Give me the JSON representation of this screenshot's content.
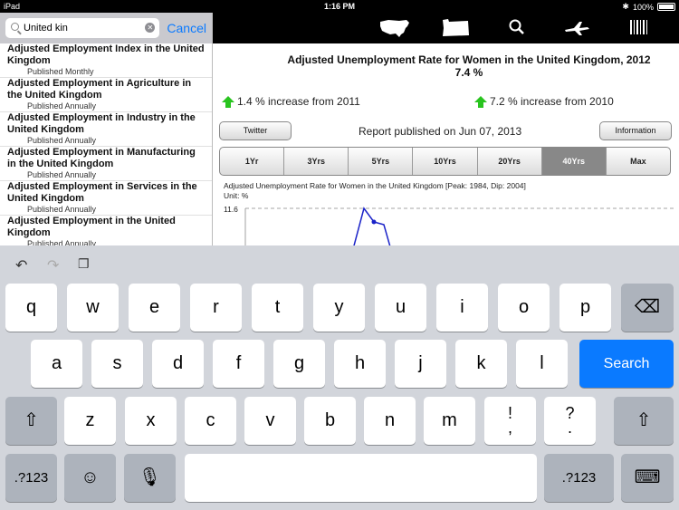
{
  "status_bar": {
    "carrier": "iPad",
    "time": "1:16 PM",
    "battery": "100%"
  },
  "search": {
    "value": "United kin",
    "cancel_label": "Cancel"
  },
  "results": [
    {
      "title": "Adjusted Employment Index in the United Kingdom",
      "frequency": "Published Monthly"
    },
    {
      "title": "Adjusted Employment in Agriculture in the United Kingdom",
      "frequency": "Published Annually"
    },
    {
      "title": "Adjusted Employment in Industry in the United Kingdom",
      "frequency": "Published Annually"
    },
    {
      "title": "Adjusted Employment in Manufacturing in the United Kingdom",
      "frequency": "Published Annually"
    },
    {
      "title": "Adjusted Employment in Services in the United Kingdom",
      "frequency": "Published Annually"
    },
    {
      "title": "Adjusted Employment in the United Kingdom",
      "frequency": "Published Annually"
    }
  ],
  "nav_icons": [
    "us-map-icon",
    "state-map-icon",
    "search-icon",
    "airplane-icon",
    "barcode-icon"
  ],
  "report": {
    "title": "Adjusted Unemployment Rate for Women in the United Kingdom, 2012",
    "value": "7.4 %",
    "change_2011": "1.4 % increase from 2011",
    "change_2010": "7.2 % increase from 2010",
    "twitter_label": "Twitter",
    "information_label": "Information",
    "published": "Report published on Jun 07, 2013",
    "ranges": [
      "1Yr",
      "3Yrs",
      "5Yrs",
      "10Yrs",
      "20Yrs",
      "40Yrs",
      "Max"
    ],
    "active_range": "40Yrs",
    "chart_title": "Adjusted Unemployment Rate for Women in the United Kingdom [Peak: 1984, Dip: 2004]",
    "chart_unit": "Unit: %",
    "chart_ymax_label": "11.6"
  },
  "chart_data": {
    "type": "line",
    "title": "Adjusted Unemployment Rate for Women in the United Kingdom [Peak: 1984, Dip: 2004]",
    "ylabel": "Unit: %",
    "y_tick_labels": [
      "11.6"
    ],
    "series": [
      {
        "values": [
          9.6,
          11.6,
          11.1,
          11.0,
          9.6
        ]
      }
    ],
    "color": "#1a22c8"
  },
  "keyboard": {
    "row1": [
      "q",
      "w",
      "e",
      "r",
      "t",
      "y",
      "u",
      "i",
      "o",
      "p"
    ],
    "row2": [
      "a",
      "s",
      "d",
      "f",
      "g",
      "h",
      "j",
      "k",
      "l"
    ],
    "row3": [
      "z",
      "x",
      "c",
      "v",
      "b",
      "n",
      "m"
    ],
    "punct1_top": "!",
    "punct1_bottom": ",",
    "punct2_top": "?",
    "punct2_bottom": ".",
    "search_label": "Search",
    "numbers_label": ".?123"
  }
}
